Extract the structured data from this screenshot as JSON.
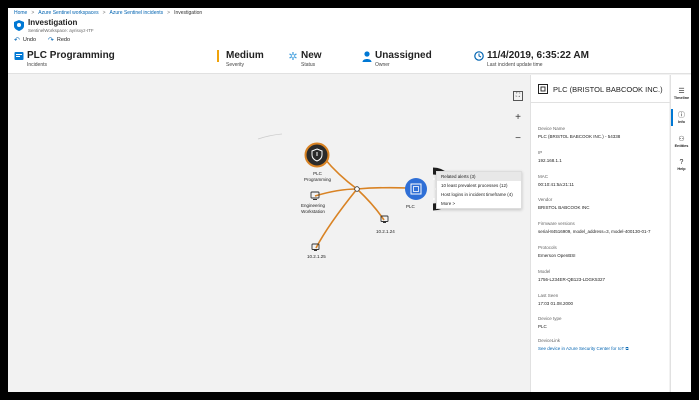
{
  "breadcrumb": [
    "Home",
    "Azure Sentinel workspaces",
    "Azure Sentinel incidents",
    "Investigation"
  ],
  "header": {
    "title": "Investigation",
    "subtitle": "SentinelWorkspace: ayrisxyz-ITF"
  },
  "toolbar": {
    "undo": "Undo",
    "redo": "Redo"
  },
  "summary": {
    "incident": {
      "value": "PLC Programming",
      "label": "Incidents"
    },
    "severity": {
      "value": "Medium",
      "label": "Severity",
      "color": "#f0a30a"
    },
    "status": {
      "value": "New",
      "label": "Status"
    },
    "owner": {
      "value": "Unassigned",
      "label": "Owner"
    },
    "updated": {
      "value": "11/4/2019, 6:35:22 AM",
      "label": "Last incident update time"
    }
  },
  "graph": {
    "nodes": {
      "plc_programming": "PLC\nProgramming",
      "engineering_workstation": "Engineering\nWorkstation",
      "ip_a": "10.2.1.24",
      "ip_b": "10.2.1.25",
      "plc": "PLC"
    },
    "context_menu": [
      "Related alerts (3)",
      "10 least prevalent processes (12)",
      "Host logins in incident timeframe (4)",
      "More >"
    ]
  },
  "details": {
    "title": "PLC (BRISTOL BABCOOK INC.)",
    "fields": [
      {
        "label": "Device Name",
        "value": "PLC (BRISTOL BABCOOK INC.) - 54338"
      },
      {
        "label": "IP",
        "value": "192.168.1.1"
      },
      {
        "label": "MAC",
        "value": "00:10:41:5a:21:11"
      },
      {
        "label": "Vendor",
        "value": "BRISTOL BABCOOK INC"
      },
      {
        "label": "Firmware versions",
        "value": "serial-84516909, model_address=3, model-400130-01-7"
      },
      {
        "label": "Protocols",
        "value": "Emerson OpenBSI"
      },
      {
        "label": "Model",
        "value": "1756-L234ER-QB123-LDGK5327"
      },
      {
        "label": "Last Seen",
        "value": "17:03 01.08.2000"
      },
      {
        "label": "Device type",
        "value": "PLC"
      },
      {
        "label": "DeviceLink",
        "value": "See device in Azure Security Center for IoT"
      }
    ]
  },
  "rightnav": [
    "Timeline",
    "Info",
    "Entities",
    "Help"
  ],
  "colors": {
    "accent": "#0078d4",
    "edge": "#d98324",
    "node_dark": "#2b2b2b",
    "plc_node": "#2f6fd6"
  }
}
